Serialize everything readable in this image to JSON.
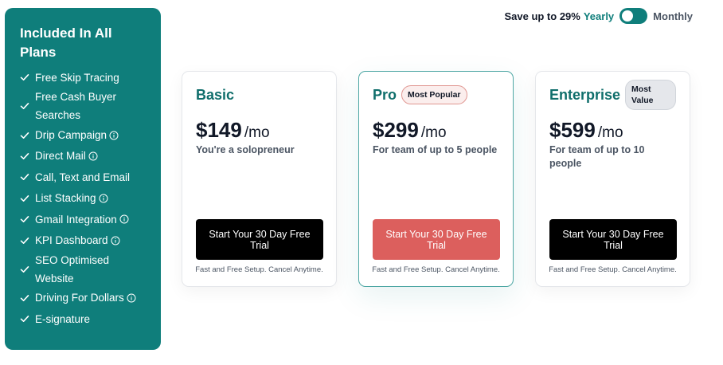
{
  "sidebar": {
    "title": "Included In All Plans",
    "features": [
      {
        "label": "Free Skip Tracing",
        "info": false
      },
      {
        "label": "Free Cash Buyer Searches",
        "info": false
      },
      {
        "label": "Drip Campaign",
        "info": true
      },
      {
        "label": "Direct Mail",
        "info": true
      },
      {
        "label": "Call, Text and Email",
        "info": false
      },
      {
        "label": "List Stacking",
        "info": true
      },
      {
        "label": "Gmail Integration",
        "info": true
      },
      {
        "label": "KPI Dashboard",
        "info": true
      },
      {
        "label": "SEO Optimised Website",
        "info": false
      },
      {
        "label": "Driving For Dollars",
        "info": true
      },
      {
        "label": "E-signature",
        "info": false
      }
    ]
  },
  "billing": {
    "save_text": "Save up to 29%",
    "yearly_label": "Yearly",
    "monthly_label": "Monthly",
    "yearly_selected": true
  },
  "plans": [
    {
      "name": "Basic",
      "badge": "",
      "price": "$149",
      "period": "/mo",
      "description": "You're a solopreneur",
      "cta": "Start Your 30 Day Free Trial",
      "note": "Fast and Free Setup. Cancel Anytime."
    },
    {
      "name": "Pro",
      "badge": "Most Popular",
      "price": "$299",
      "period": "/mo",
      "description": "For team of up to 5 people",
      "cta": "Start Your 30 Day Free Trial",
      "note": "Fast and Free Setup. Cancel Anytime."
    },
    {
      "name": "Enterprise",
      "badge": "Most Value",
      "price": "$599",
      "period": "/mo",
      "description": "For team of up to 10 people",
      "cta": "Start Your 30 Day Free Trial",
      "note": "Fast and Free Setup. Cancel Anytime."
    }
  ],
  "colors": {
    "brand_teal": "#0f7e7b",
    "cta_dark": "#000000",
    "cta_highlight": "#dc5f5d"
  }
}
